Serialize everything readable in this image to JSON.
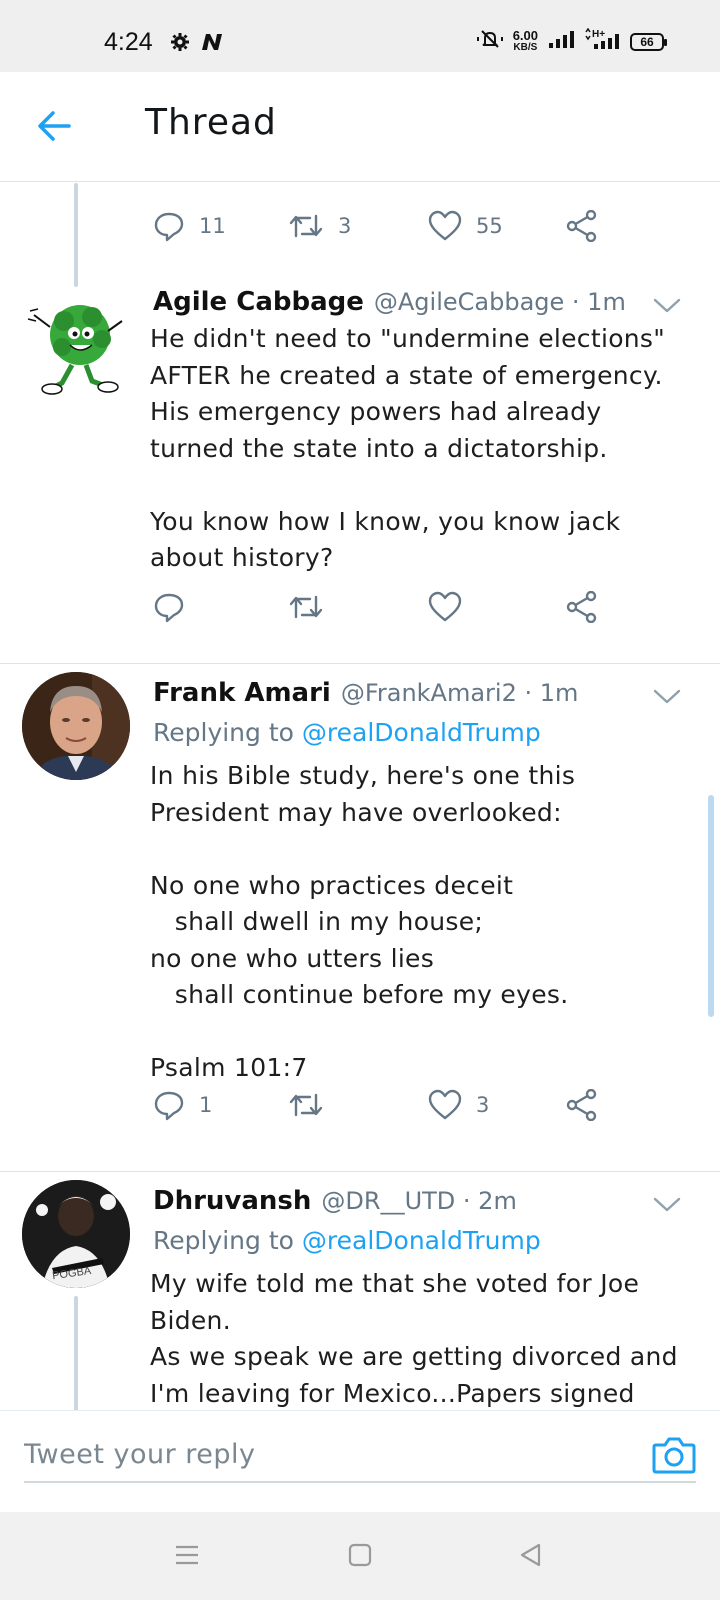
{
  "status_bar": {
    "time": "4:24",
    "net_speed_value": "6.00",
    "net_speed_unit": "KB/S",
    "battery": "66",
    "icons": [
      "gear-icon",
      "n-icon",
      "mute-icon",
      "signal-icon",
      "h-plus-icon",
      "battery-icon"
    ]
  },
  "header": {
    "title": "Thread",
    "back_icon": "arrow-left-icon"
  },
  "top_tweet_actions": {
    "replies": "11",
    "retweets": "3",
    "likes": "55"
  },
  "tweets": [
    {
      "name": "Agile Cabbage",
      "handle_time": "@AgileCabbage · 1m",
      "text": "He didn't need to \"undermine elections\"\nAFTER he created a state of emergency.\nHis emergency powers had already\nturned the state into a dictatorship.\n\nYou know how I know, you know jack\nabout history?",
      "replies": "",
      "retweets": "",
      "likes": ""
    },
    {
      "name": "Frank Amari",
      "handle_time": "@FrankAmari2 · 1m",
      "replying_prefix": "Replying to",
      "replying_to": "@realDonaldTrump",
      "text": "In his Bible study, here's one this\nPresident may have overlooked:\n\nNo one who practices deceit\n   shall dwell in my house;\nno one who utters lies\n   shall continue before my eyes.\n\nPsalm 101:7",
      "replies": "1",
      "retweets": "",
      "likes": "3"
    },
    {
      "name": "Dhruvansh",
      "handle_time": "@DR__UTD · 2m",
      "replying_prefix": "Replying to",
      "replying_to": "@realDonaldTrump",
      "avatar_text": "POGBA",
      "text": "My wife told me that she voted for Joe\nBiden.\nAs we speak we are getting divorced and\nI'm leaving for Mexico...Papers signed"
    }
  ],
  "reply_bar": {
    "placeholder": "Tweet your reply",
    "camera_icon": "camera-icon"
  },
  "colors": {
    "accent": "#1da1f2",
    "muted": "#657786",
    "divider": "#dfe3e6"
  }
}
